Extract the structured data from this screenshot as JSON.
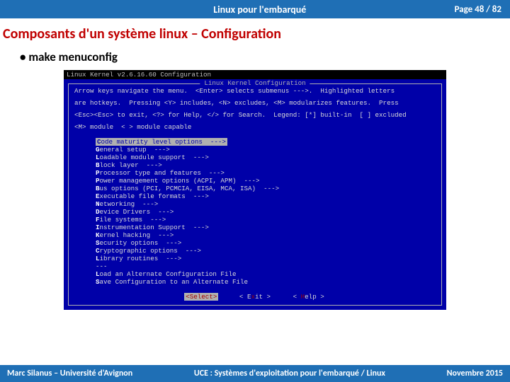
{
  "header": {
    "title": "Linux pour l'embarqué",
    "page": "Page 48 / 82"
  },
  "heading": "Composants d'un système linux – Configuration",
  "bullet": "make menuconfig",
  "terminal": {
    "line": "Linux Kernel v2.6.16.60 Configuration"
  },
  "box": {
    "title": "Linux Kernel Configuration",
    "help1": "Arrow keys navigate the menu.  <Enter> selects submenus --->.  Highlighted letters",
    "help2": "are hotkeys.  Pressing <Y> includes, <N> excludes, <M> modularizes features.  Press",
    "help3": "<Esc><Esc> to exit, <?> for Help, </> for Search.  Legend: [*] built-in  [ ] excluded",
    "help4": "<M> module  < > module capable",
    "items": [
      {
        "hk": "C",
        "rest": "ode maturity level options  --->",
        "sel": true
      },
      {
        "hk": "G",
        "rest": "eneral setup  --->"
      },
      {
        "hk": "L",
        "rest": "oadable module support  --->"
      },
      {
        "hk": "B",
        "rest": "lock layer  --->"
      },
      {
        "hk": "P",
        "rest": "rocessor type and features  --->"
      },
      {
        "hk": "P",
        "rest": "ower management options (ACPI, APM)  --->"
      },
      {
        "hk": "B",
        "rest": "us options (PCI, PCMCIA, EISA, MCA, ISA)  --->"
      },
      {
        "hk": "E",
        "rest": "xecutable file formats  --->"
      },
      {
        "hk": "N",
        "rest": "etworking  --->"
      },
      {
        "hk": "D",
        "rest": "evice Drivers  --->"
      },
      {
        "hk": "F",
        "rest": "ile systems  --->"
      },
      {
        "hk": "I",
        "rest": "nstrumentation Support  --->"
      },
      {
        "hk": "K",
        "rest": "ernel hacking  --->"
      },
      {
        "hk": "S",
        "rest": "ecurity options  --->"
      },
      {
        "hk": "C",
        "rest": "ryptographic options  --->"
      },
      {
        "hk": "L",
        "rest": "ibrary routines  --->"
      }
    ],
    "dashes": "---",
    "load": {
      "hk": "L",
      "rest": "oad an Alternate Configuration File"
    },
    "save": {
      "hk": "S",
      "rest": "ave Configuration to an Alternate File"
    },
    "buttons": {
      "select": "<Select>",
      "exit_l": "< E",
      "exit_hk": "x",
      "exit_r": "it >",
      "help_l": "< ",
      "help_hk": "H",
      "help_r": "elp >"
    }
  },
  "footer": {
    "left": "Marc Silanus – Université d'Avignon",
    "mid": "UCE : Systèmes d'exploitation pour l'embarqué / Linux",
    "right": "Novembre 2015"
  }
}
